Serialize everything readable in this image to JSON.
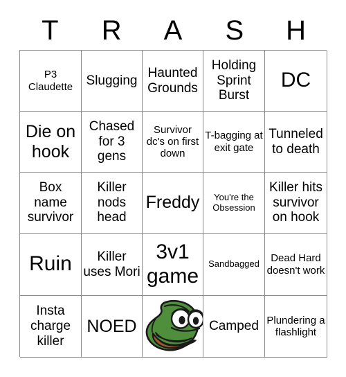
{
  "header": {
    "letters": [
      "T",
      "R",
      "A",
      "S",
      "H"
    ]
  },
  "grid": {
    "rows": 5,
    "columns": 5,
    "cells": [
      [
        {
          "text": "P3 Claudette",
          "size": "sm",
          "type": "text"
        },
        {
          "text": "Slugging",
          "size": "md",
          "type": "text"
        },
        {
          "text": "Haunted Grounds",
          "size": "md",
          "type": "text"
        },
        {
          "text": "Holding Sprint Burst",
          "size": "md",
          "type": "text"
        },
        {
          "text": "DC",
          "size": "xl",
          "type": "text"
        }
      ],
      [
        {
          "text": "Die on hook",
          "size": "lg",
          "type": "text"
        },
        {
          "text": "Chased for 3 gens",
          "size": "md",
          "type": "text"
        },
        {
          "text": "Survivor dc's on first down",
          "size": "sm",
          "type": "text"
        },
        {
          "text": "T-bagging at exit gate",
          "size": "sm",
          "type": "text"
        },
        {
          "text": "Tunneled to death",
          "size": "md",
          "type": "text"
        }
      ],
      [
        {
          "text": "Box name survivor",
          "size": "md",
          "type": "text"
        },
        {
          "text": "Killer nods head",
          "size": "md",
          "type": "text"
        },
        {
          "text": "Freddy",
          "size": "lg",
          "type": "text"
        },
        {
          "text": "You're the Obsession",
          "size": "xs",
          "type": "text"
        },
        {
          "text": "Killer hits survivor on hook",
          "size": "md",
          "type": "text"
        }
      ],
      [
        {
          "text": "Ruin",
          "size": "xl",
          "type": "text"
        },
        {
          "text": "Killer uses Mori",
          "size": "md",
          "type": "text"
        },
        {
          "text": "3v1 game",
          "size": "xl",
          "type": "text"
        },
        {
          "text": "Sandbagged",
          "size": "xs",
          "type": "text"
        },
        {
          "text": "Dead Hard doesn't work",
          "size": "sm",
          "type": "text"
        }
      ],
      [
        {
          "text": "Insta charge killer",
          "size": "md",
          "type": "text"
        },
        {
          "text": "NOED",
          "size": "lg",
          "type": "text"
        },
        {
          "text": "",
          "size": "md",
          "type": "image",
          "image": "pepe-frog-face"
        },
        {
          "text": "Camped",
          "size": "md",
          "type": "text"
        },
        {
          "text": "Plundering a flashlight",
          "size": "sm",
          "type": "text"
        }
      ]
    ]
  },
  "colors": {
    "background": "#ffffff",
    "text": "#000000",
    "grid_line": "#8a8a8a",
    "pepe_green": "#4f8f3c",
    "pepe_green_dark": "#3d7330",
    "pepe_outline": "#1a1a1a",
    "pepe_mouth_pink": "#e8317a",
    "pepe_mouth_light": "#f0a8c0",
    "pepe_lip_brown": "#9a5a2a",
    "pepe_eye_white": "#ffffff"
  }
}
